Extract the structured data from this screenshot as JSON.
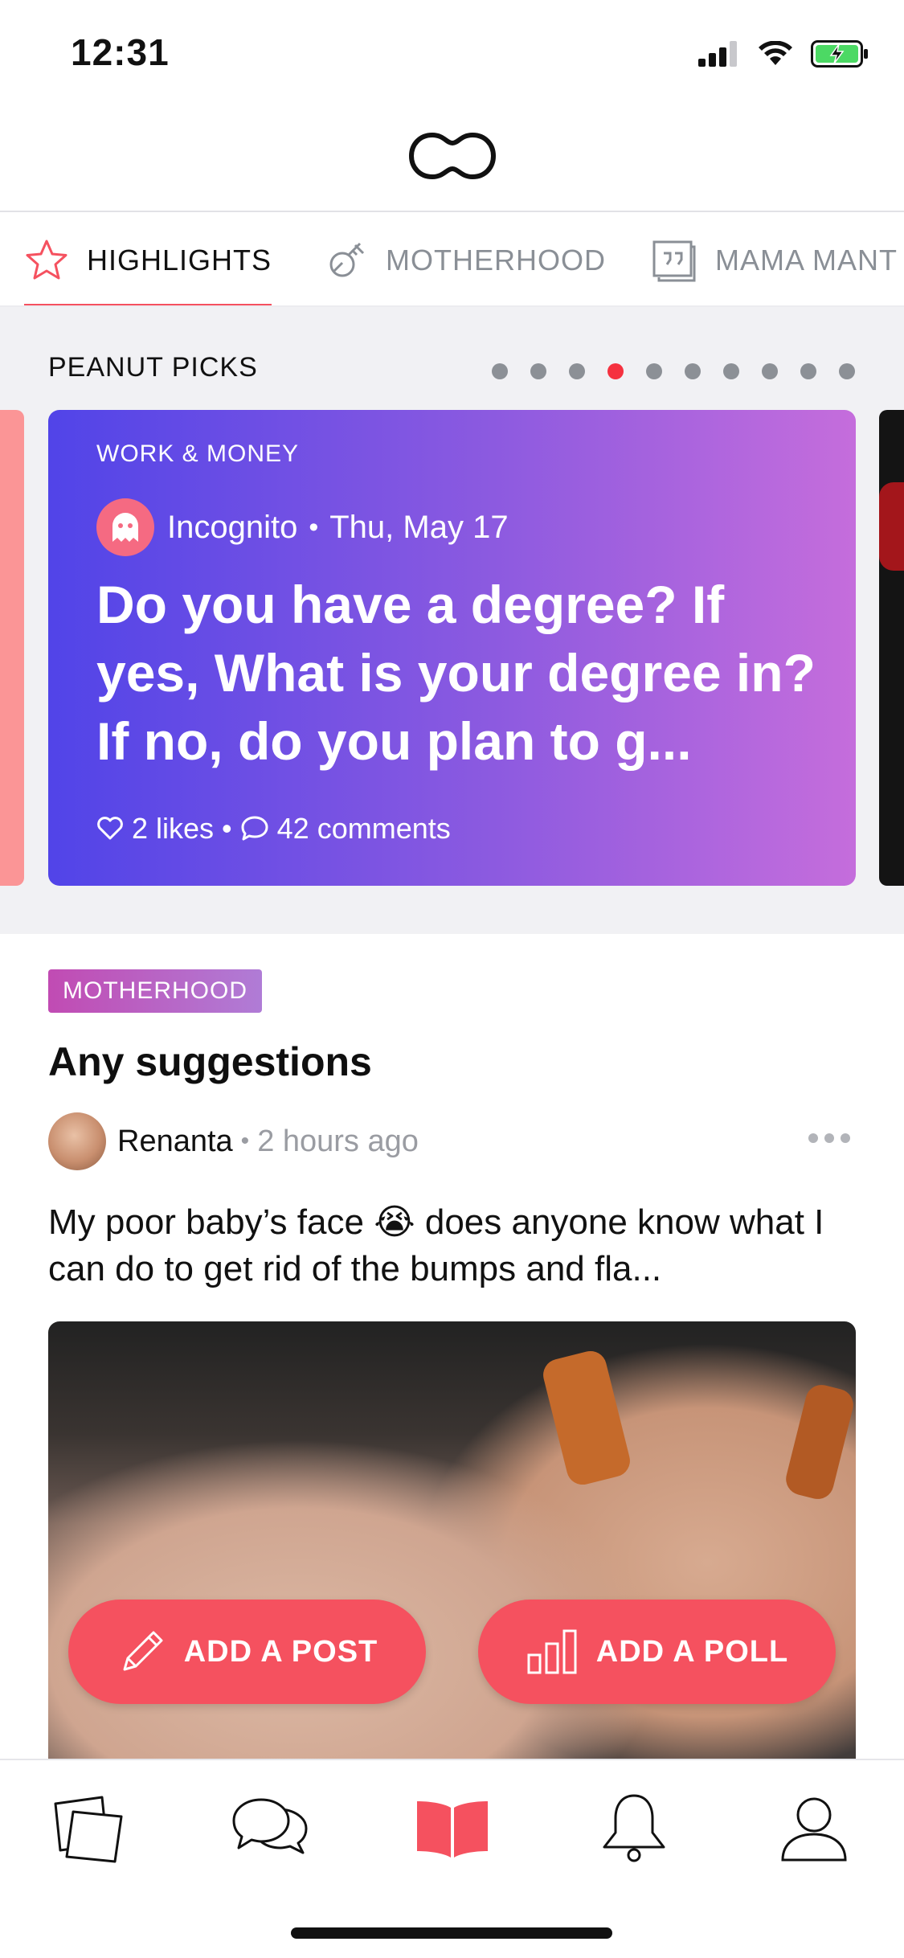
{
  "status_bar": {
    "time": "12:31"
  },
  "tabs": [
    {
      "label": "HIGHLIGHTS",
      "icon": "star-icon",
      "active": true
    },
    {
      "label": "MOTHERHOOD",
      "icon": "baby-bottle-icon",
      "active": false
    },
    {
      "label": "MAMA MANT",
      "icon": "quote-icon",
      "active": false
    }
  ],
  "picks": {
    "title": "PEANUT PICKS",
    "dots_total": 10,
    "active_dot": 4,
    "card": {
      "category": "WORK & MONEY",
      "author": "Incognito",
      "date": "Thu, May 17",
      "question": "Do you have a degree? If yes, What is your degree in? If no, do you plan to g...",
      "likes": "2 likes",
      "comments": "42 comments"
    }
  },
  "post": {
    "tag": "MOTHERHOOD",
    "title": "Any suggestions",
    "author": "Renanta",
    "time": "2 hours ago",
    "body_before_emoji": "My poor baby’s face",
    "emoji": "😭",
    "body_after_emoji": " does anyone know what I can do to get rid of the bumps and fla..."
  },
  "actions": {
    "add_post": "ADD A POST",
    "add_poll": "ADD A POLL"
  },
  "tabbar": [
    {
      "icon": "cards-icon"
    },
    {
      "icon": "chat-icon"
    },
    {
      "icon": "book-icon",
      "active": true
    },
    {
      "icon": "bell-icon"
    },
    {
      "icon": "profile-icon"
    }
  ],
  "colors": {
    "accent": "#f5515f",
    "card_gradient_start": "#5144e8",
    "card_gradient_end": "#c56ddc",
    "tag_gradient_start": "#c14bb3"
  }
}
